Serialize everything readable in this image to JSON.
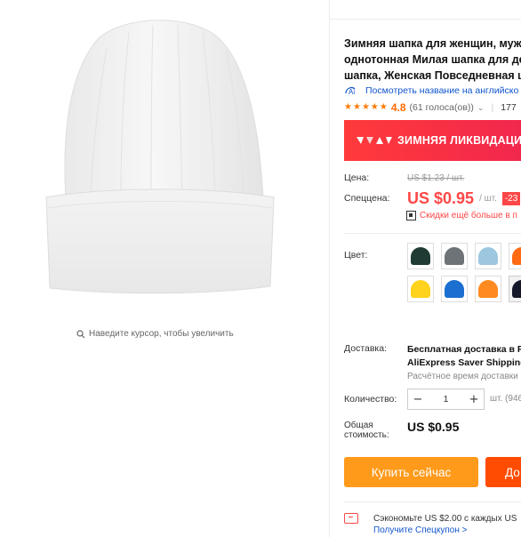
{
  "gallery": {
    "zoom_hint": "Наведите курсор, чтобы увеличить"
  },
  "product": {
    "title_lines": [
      "Зимняя шапка для женщин, мужс",
      "однотонная Милая шапка для дев",
      "шапка, Женская Повседневная ш"
    ],
    "translate_link": "Посмотреть название на английско",
    "rating": "4.8",
    "stars": 5,
    "votes": "(61 голоса(ов))",
    "orders": "177"
  },
  "promo": {
    "text": "ЗИМНЯЯ ЛИКВИДАЦИЯ"
  },
  "price": {
    "price_label": "Цена:",
    "old_price": "US $1.23 / шт.",
    "special_label": "Спеццена:",
    "new_price": "US $0.95",
    "per_unit": "/ шт.",
    "discount": "-23",
    "coupon_text": "Скидки ещё больше в п"
  },
  "colors": {
    "label": "Цвет:",
    "swatches": [
      {
        "name": "dark-green",
        "color": "#1f3b33"
      },
      {
        "name": "gray",
        "color": "#6e7377"
      },
      {
        "name": "light-blue",
        "color": "#9cc7df"
      },
      {
        "name": "orange",
        "color": "#ff6a13"
      },
      {
        "name": "mint-green",
        "color": "#3de07a"
      },
      {
        "name": "yellow",
        "color": "#ffd21c"
      },
      {
        "name": "blue",
        "color": "#1a6fd0"
      },
      {
        "name": "orange-2",
        "color": "#ff8a1f"
      },
      {
        "name": "navy",
        "color": "#15182a"
      }
    ]
  },
  "shipping": {
    "label": "Доставка:",
    "line1": "Бесплатная доставка в R",
    "line2": "AliExpress Saver Shipping",
    "line3": "Расчётное время доставки"
  },
  "quantity": {
    "label": "Количество:",
    "minus": "−",
    "value": "1",
    "plus": "+",
    "unit": "шт. (946"
  },
  "total": {
    "label_line1": "Общая",
    "label_line2": "стоимость:",
    "value": "US $0.95"
  },
  "buttons": {
    "buy_now": "Купить сейчас",
    "add_to_cart": "До"
  },
  "savings": {
    "text": "Сэкономьте US $2.00 с каждых US",
    "link": "Получите Спецкупон >"
  }
}
